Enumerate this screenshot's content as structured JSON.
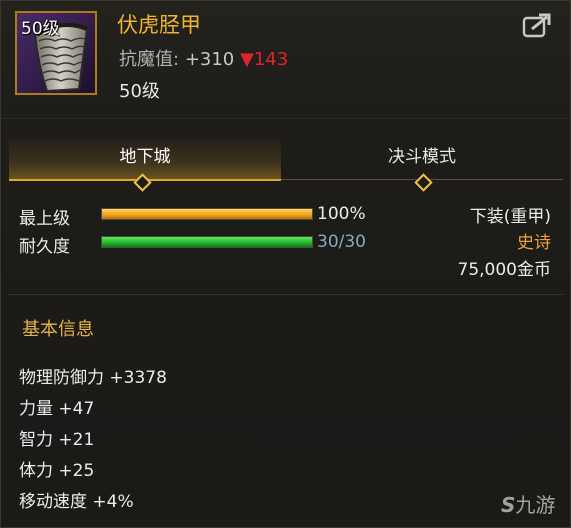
{
  "item": {
    "level_badge": "50级",
    "name": "伏虎胫甲",
    "magic_label": "抗魔值:",
    "magic_value": "+310",
    "magic_down_arrow": "▼",
    "magic_diff": "143",
    "required_level": "50级"
  },
  "tabs": [
    {
      "label": "地下城",
      "active": true
    },
    {
      "label": "决斗模式",
      "active": false
    }
  ],
  "stats": {
    "level": {
      "label": "最上级",
      "value": "100%",
      "fill_fraction": 1.0,
      "color": "#f0a01c"
    },
    "durability": {
      "label": "耐久度",
      "value": "30/30",
      "fill_fraction": 1.0,
      "color": "#22b22a"
    }
  },
  "info": {
    "slot": "下装(重甲)",
    "rarity": "史诗",
    "price": "75,000金币"
  },
  "colors": {
    "accent": "#f0b431",
    "rarity": "#f2a13a",
    "durability_value": "#8ea6c8",
    "magic_down": "#e0242a"
  },
  "basic_info": {
    "title": "基本信息",
    "attributes": [
      "物理防御力 +3378",
      "力量 +47",
      "智力 +21",
      "体力 +25",
      "移动速度 +4%"
    ]
  },
  "watermark": "九游",
  "icons": [
    "greave-item-icon",
    "share-icon",
    "tab-diamond-icon",
    "jiuyou-logo-icon"
  ]
}
